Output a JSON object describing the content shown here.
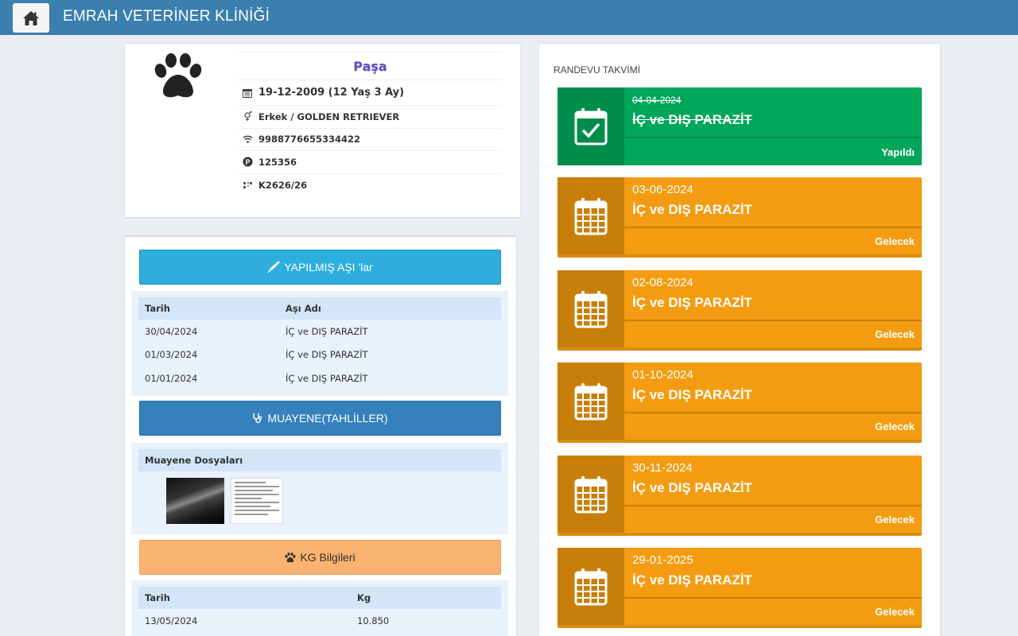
{
  "header": {
    "title": "EMRAH VETERİNER KLİNİĞİ",
    "home_icon": "home-icon"
  },
  "pet": {
    "name": "Paşa",
    "birth": "19-12-2009 (12 Yaş 3 Ay)",
    "gender_breed": "Erkek / GOLDEN RETRIEVER",
    "chip": "9988776655334422",
    "parking": "125356",
    "code": "K2626/26"
  },
  "vaccines": {
    "button_label": "YAPILMIŞ AŞI 'lar",
    "col_date": "Tarih",
    "col_name": "Aşı Adı",
    "rows": [
      {
        "date": "30/04/2024",
        "name": "İÇ ve DIŞ PARAZİT"
      },
      {
        "date": "01/03/2024",
        "name": "İÇ ve DIŞ PARAZİT"
      },
      {
        "date": "01/01/2024",
        "name": "İÇ ve DIŞ PARAZİT"
      }
    ]
  },
  "exam": {
    "button_label": "MUAYENE(TAHLİLLER)",
    "files_label": "Muayene Dosyaları"
  },
  "weight": {
    "button_label": "KG Bilgileri",
    "col_date": "Tarih",
    "col_kg": "Kg",
    "rows": [
      {
        "date": "13/05/2024",
        "kg": "10.850"
      }
    ]
  },
  "calendar": {
    "title": "RANDEVU TAKVİMİ",
    "appointments": [
      {
        "date": "04-04-2024",
        "title": "İÇ ve DIŞ PARAZİT",
        "status": "Yapıldı"
      },
      {
        "date": "03-06-2024",
        "title": "İÇ ve DIŞ PARAZİT",
        "status": "Gelecek"
      },
      {
        "date": "02-08-2024",
        "title": "İÇ ve DIŞ PARAZİT",
        "status": "Gelecek"
      },
      {
        "date": "01-10-2024",
        "title": "İÇ ve DIŞ PARAZİT",
        "status": "Gelecek"
      },
      {
        "date": "30-11-2024",
        "title": "İÇ ve DIŞ PARAZİT",
        "status": "Gelecek"
      },
      {
        "date": "29-01-2025",
        "title": "İÇ ve DIŞ PARAZİT",
        "status": "Gelecek"
      }
    ]
  },
  "colors": {
    "header": "#3a7fae",
    "done": "#00a65a",
    "future": "#f39c12",
    "accent_name": "#5b4fc9"
  }
}
